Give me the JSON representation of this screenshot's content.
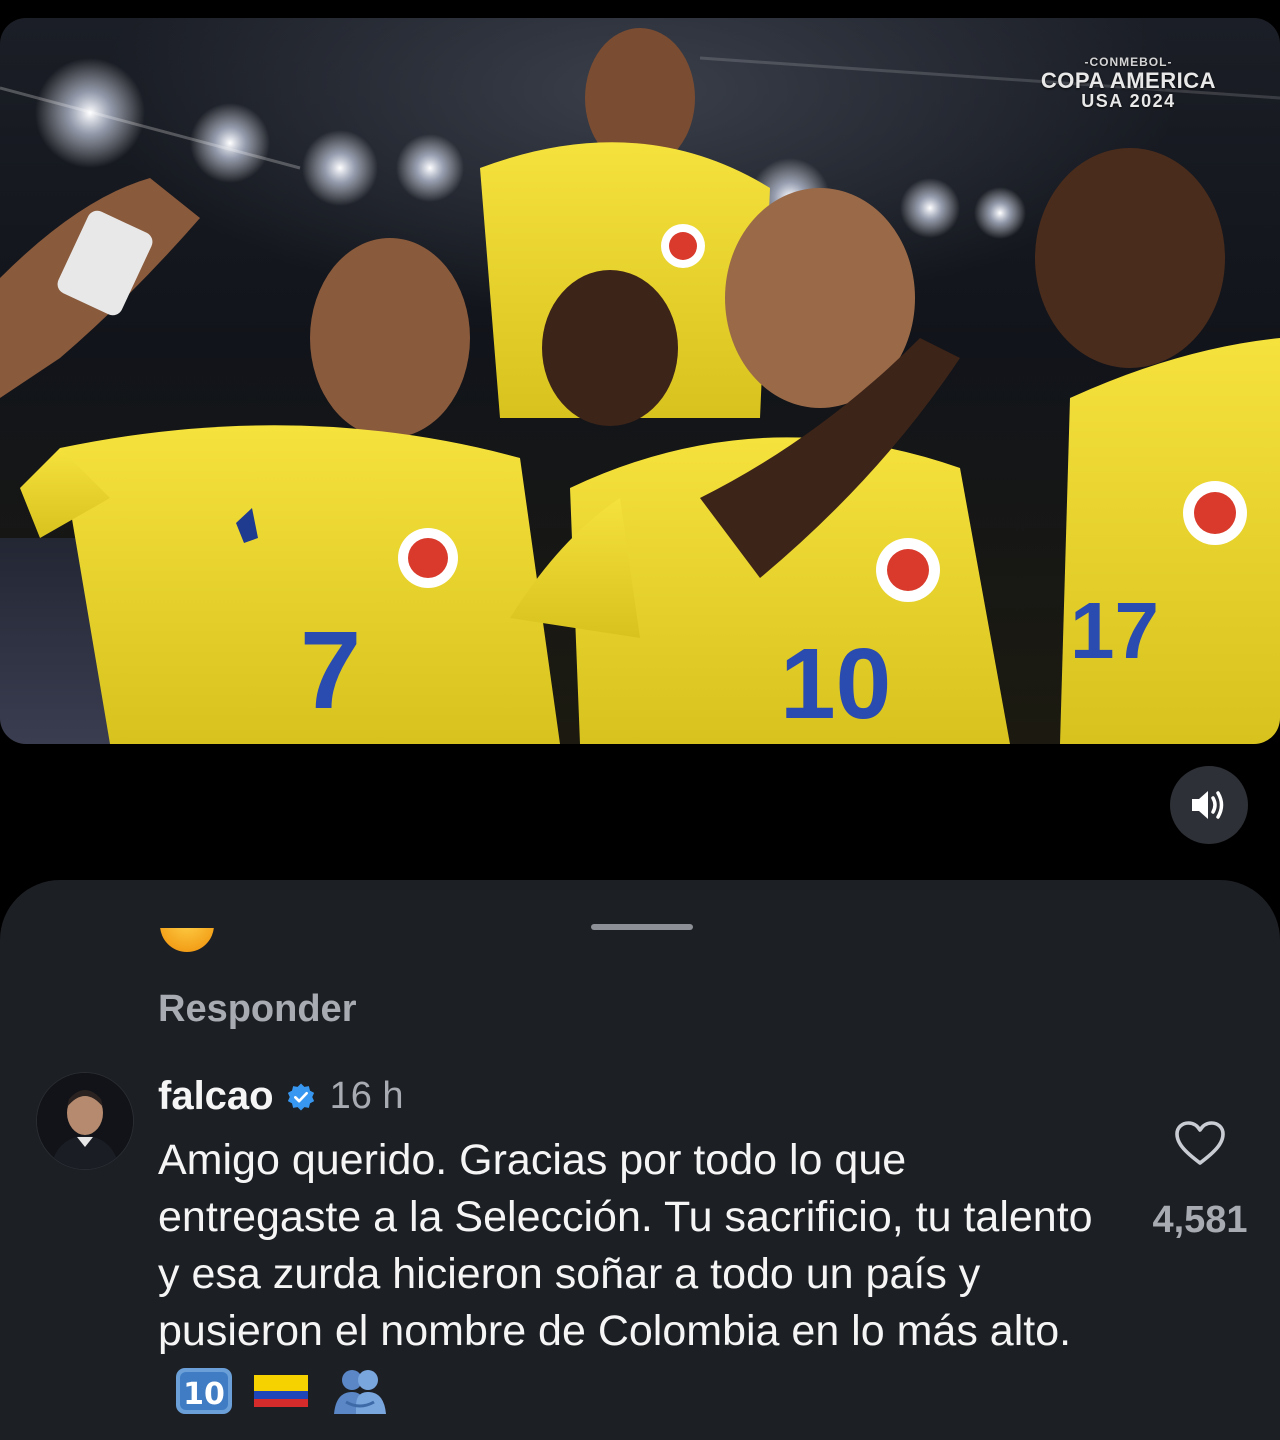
{
  "video": {
    "broadcast_logo": {
      "org": "-CONMEBOL-",
      "event": "COPA AMERICA",
      "year": "USA 2024"
    },
    "jersey_numbers": [
      "7",
      "10",
      "17"
    ],
    "mute_icon": "speaker-on-icon"
  },
  "comments_sheet": {
    "previous_comment": {
      "emoji_icon": "smiling-face-emoji",
      "reply_label": "Responder"
    },
    "comment": {
      "username": "falcao",
      "verified": true,
      "timestamp": "16 h",
      "text": "Amigo querido. Gracias por todo lo que entregaste a la Selección. Tu sacrificio, tu talento y esa zurda hicieron soñar a todo un país y pusieron el nombre de Colombia en lo más alto.",
      "emojis": [
        "keycap-ten-emoji",
        "colombia-flag-emoji",
        "people-hugging-emoji"
      ],
      "like_icon": "heart-outline-icon",
      "like_count": "4,581"
    }
  },
  "colors": {
    "background": "#000000",
    "sheet": "#1c1f24",
    "secondary_text": "#a8abb1",
    "verified_blue": "#3897f0",
    "jersey_yellow": "#f2de2a"
  }
}
